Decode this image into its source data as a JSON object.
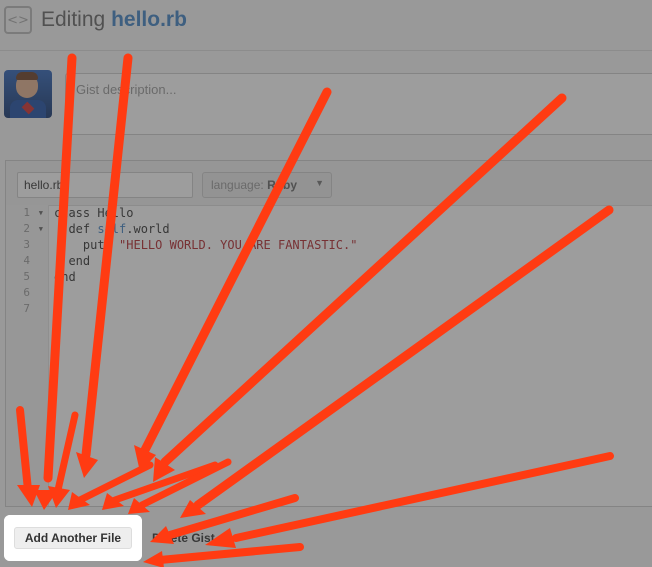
{
  "header": {
    "title_prefix": "Editing",
    "title_file": "hello.rb",
    "icon": "gist-icon"
  },
  "description": {
    "placeholder": "Gist description..."
  },
  "file": {
    "filename": "hello.rb",
    "language_label": "language:",
    "language_value": "Ruby",
    "lines": [
      {
        "n": "1",
        "fold": true
      },
      {
        "n": "2",
        "fold": true
      },
      {
        "n": "3",
        "fold": false
      },
      {
        "n": "4",
        "fold": false
      },
      {
        "n": "5",
        "fold": false
      },
      {
        "n": "6",
        "fold": false
      },
      {
        "n": "7",
        "fold": false
      }
    ],
    "code": {
      "l1": "class Hello",
      "l2_def": "  def ",
      "l2_self": "self",
      "l2_rest": ".world",
      "l3_puts": "    puts ",
      "l3_str": "\"HELLO WORLD. YOU ARE FANTASTIC.\"",
      "l4": "  end",
      "l5": "end"
    }
  },
  "actions": {
    "add_file": "Add Another File",
    "delete": "Delete Gist"
  },
  "colors": {
    "link": "#4183c4",
    "arrow": "#ff3b12",
    "string": "#b3262d"
  }
}
